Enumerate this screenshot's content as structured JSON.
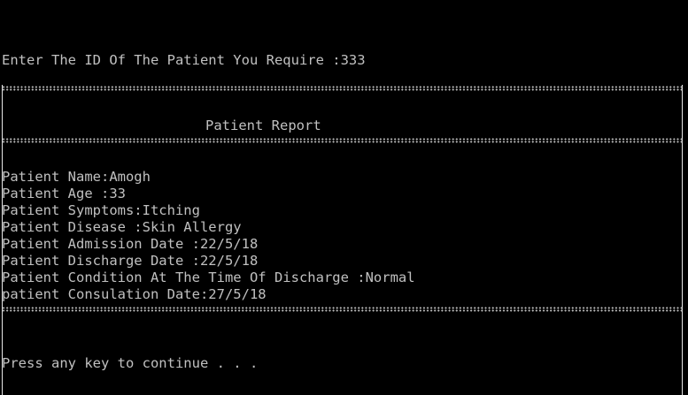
{
  "console": {
    "prompt": "Enter The ID Of The Patient You Require :333",
    "report_title": "Patient Report",
    "fields": [
      "Patient Name:Amogh",
      "Patient Age :33",
      "Patient Symptoms:Itching",
      "Patient Disease :Skin Allergy",
      "Patient Admission Date :22/5/18",
      "Patient Discharge Date :22/5/18",
      "Patient Condition At The Time Of Discharge :Normal",
      "patient Consulation Date:27/5/18"
    ],
    "continue_msg": "Press any key to continue . . ."
  },
  "colors": {
    "background": "#000000",
    "text": "#c0c0c0"
  }
}
